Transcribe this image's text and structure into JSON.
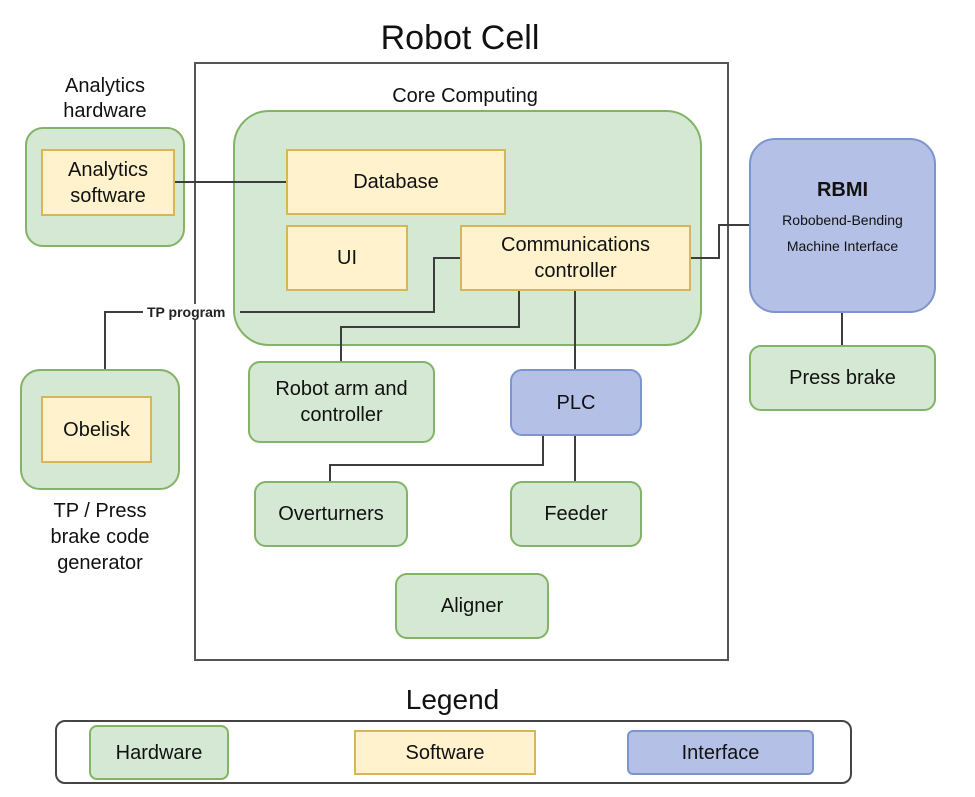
{
  "diagram": {
    "title": "Robot Cell",
    "core_computing_label": "Core Computing",
    "analytics_hardware_label": "Analytics hardware",
    "analytics_software": "Analytics software",
    "database": "Database",
    "ui": "UI",
    "communications_controller": "Communications controller",
    "rbmi_title": "RBMI",
    "rbmi_subtitle": "Robobend-Bending Machine Interface",
    "press_brake": "Press brake",
    "obelisk": "Obelisk",
    "obelisk_caption": "TP / Press brake code generator",
    "tp_program_edge_label": "TP program",
    "robot_arm": "Robot arm and controller",
    "plc": "PLC",
    "overturners": "Overturners",
    "feeder": "Feeder",
    "aligner": "Aligner"
  },
  "legend": {
    "title": "Legend",
    "items": [
      {
        "label": "Hardware",
        "kind": "hardware",
        "fill": "#d5e8d4",
        "stroke": "#82b366"
      },
      {
        "label": "Software",
        "kind": "software",
        "fill": "#fff2cc",
        "stroke": "#d6b656"
      },
      {
        "label": "Interface",
        "kind": "interface",
        "fill": "#b4c0e6",
        "stroke": "#7c95cf"
      }
    ]
  }
}
